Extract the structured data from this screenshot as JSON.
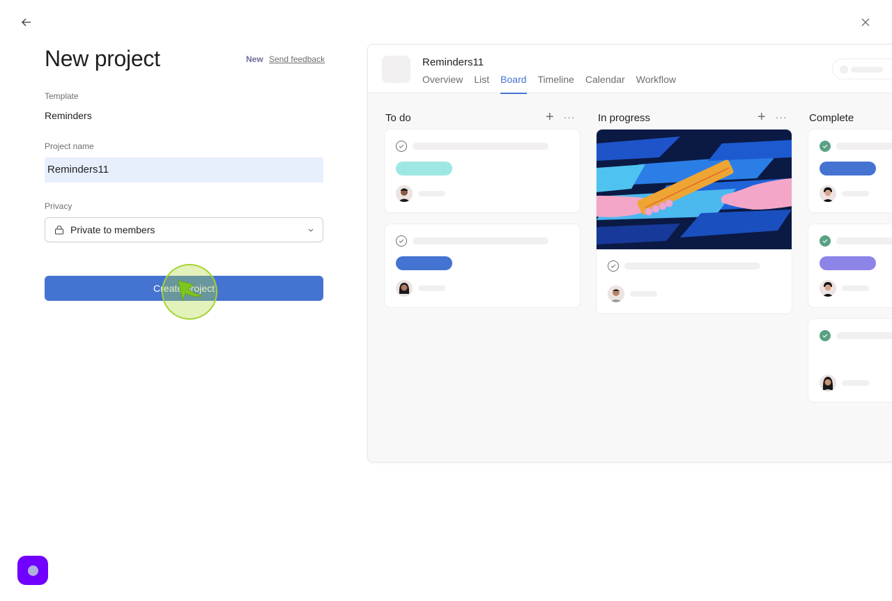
{
  "nav": {
    "back_icon": "arrow-left-icon",
    "close_icon": "close-icon"
  },
  "form": {
    "title": "New project",
    "new_badge": "New",
    "feedback_link": "Send feedback",
    "template_label": "Template",
    "template_value": "Reminders",
    "name_label": "Project name",
    "name_value": "Reminders11",
    "privacy_label": "Privacy",
    "privacy_value": "Private to members",
    "privacy_icon": "lock-icon",
    "create_button": "Create project"
  },
  "preview": {
    "project_title": "Reminders11",
    "tabs": [
      {
        "label": "Overview",
        "active": false
      },
      {
        "label": "List",
        "active": false
      },
      {
        "label": "Board",
        "active": true
      },
      {
        "label": "Timeline",
        "active": false
      },
      {
        "label": "Calendar",
        "active": false
      },
      {
        "label": "Workflow",
        "active": false
      }
    ],
    "columns": [
      {
        "title": "To do",
        "add": "+",
        "more": "···"
      },
      {
        "title": "In progress",
        "add": "+",
        "more": "···"
      },
      {
        "title": "Complete"
      }
    ],
    "tag_colors": {
      "teal": "#9ee7e3",
      "blue": "#4573d2",
      "purple": "#8d84e8"
    }
  },
  "colors": {
    "accent": "#4573d2",
    "complete_green": "#58a182",
    "help_button": "#7000ff"
  }
}
